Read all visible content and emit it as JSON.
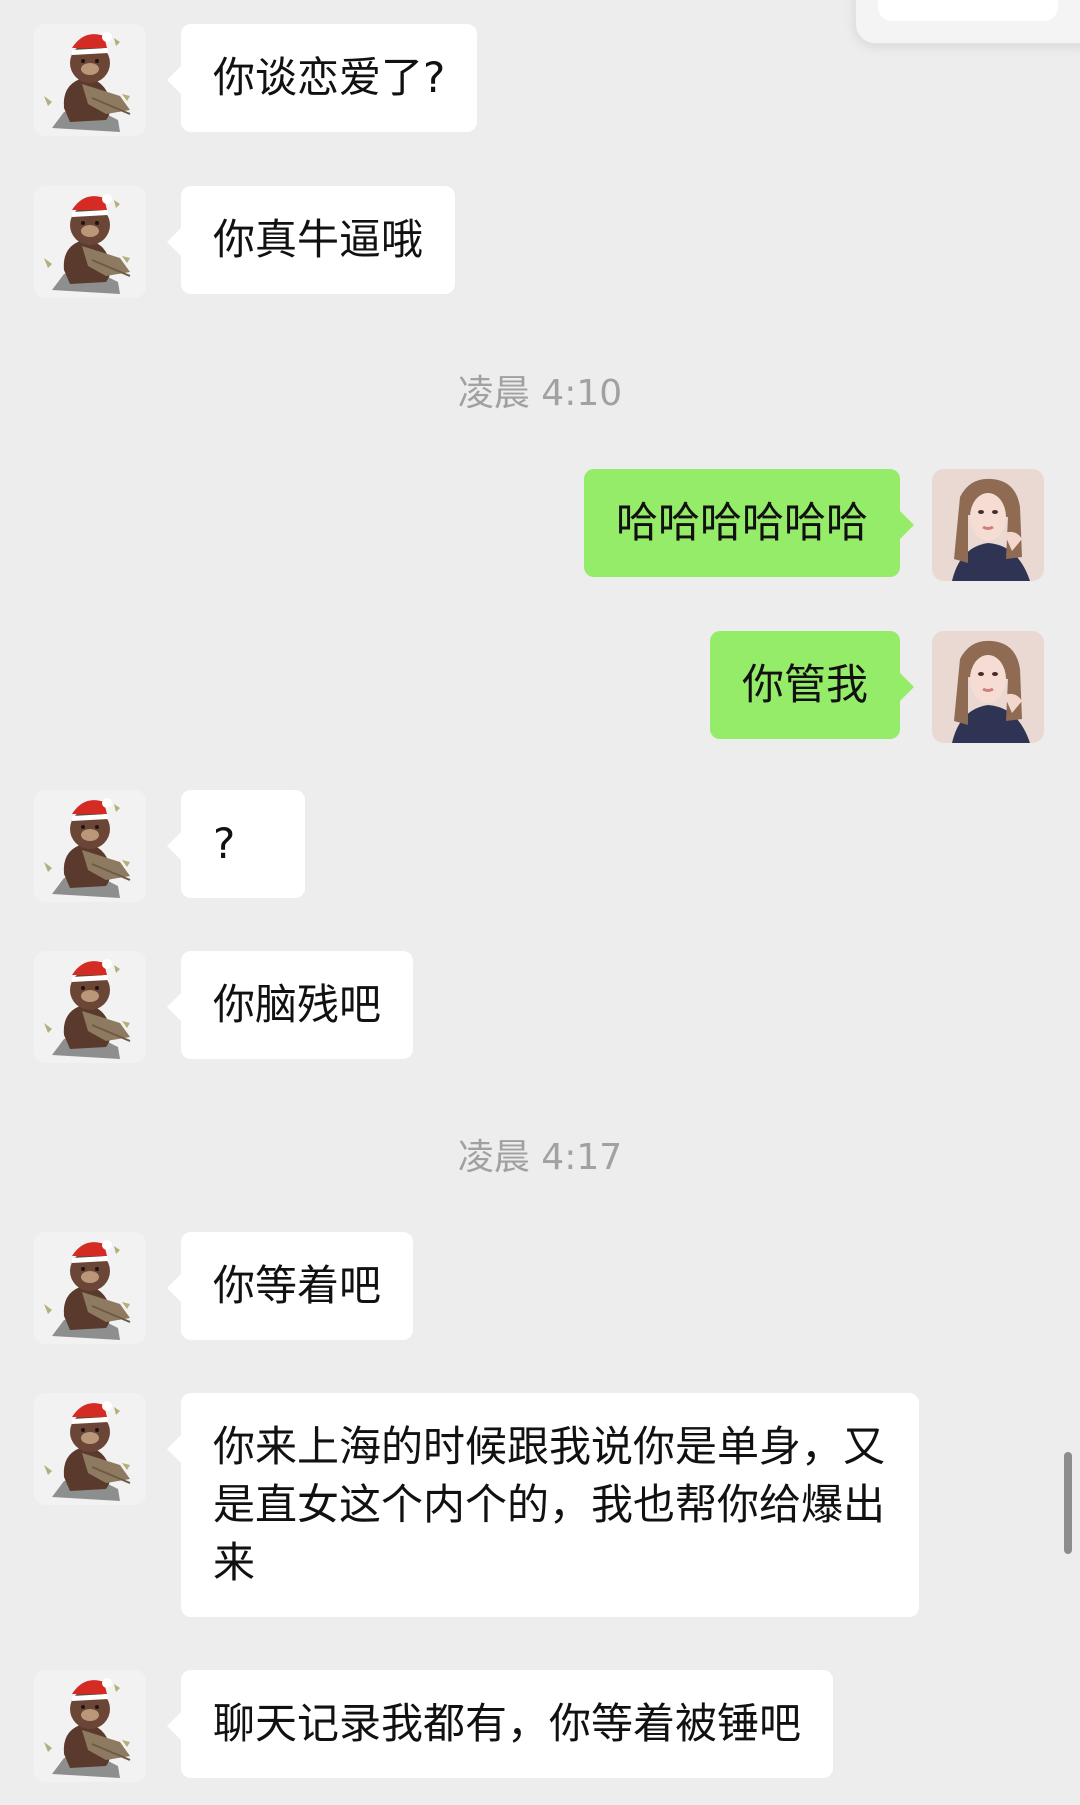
{
  "messages": [
    {
      "side": "left",
      "avatar": "brown-bear-avatar",
      "text": "你谈恋爱了?"
    },
    {
      "side": "left",
      "avatar": "brown-bear-avatar",
      "text": "你真牛逼哦"
    },
    {
      "side": "timestamp",
      "text": "凌晨 4:10"
    },
    {
      "side": "right",
      "avatar": "girl-portrait-avatar",
      "text": "哈哈哈哈哈哈"
    },
    {
      "side": "right",
      "avatar": "girl-portrait-avatar",
      "text": "你管我"
    },
    {
      "side": "left",
      "avatar": "brown-bear-avatar",
      "text": "?"
    },
    {
      "side": "left",
      "avatar": "brown-bear-avatar",
      "text": "你脑残吧"
    },
    {
      "side": "timestamp",
      "text": "凌晨 4:17"
    },
    {
      "side": "left",
      "avatar": "brown-bear-avatar",
      "text": "你等着吧"
    },
    {
      "side": "left",
      "avatar": "brown-bear-avatar",
      "text": "你来上海的时候跟我说你是单身，又是直女这个内个的，我也帮你给爆出来"
    },
    {
      "side": "left",
      "avatar": "brown-bear-avatar",
      "text": "聊天记录我都有，你等着被锤吧"
    }
  ],
  "colors": {
    "background": "#ededed",
    "incoming_bubble": "#ffffff",
    "outgoing_bubble": "#95ec69",
    "timestamp_text": "#a1a1a1"
  }
}
